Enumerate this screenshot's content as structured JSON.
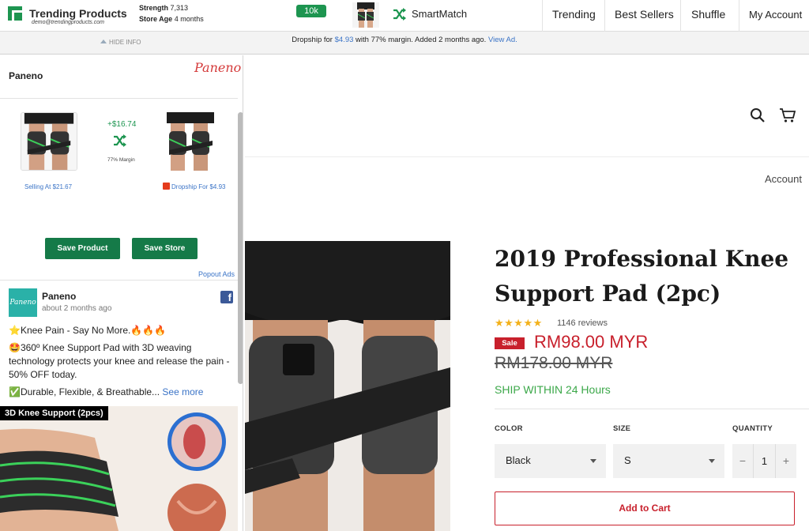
{
  "topbar": {
    "brand_title": "Trending Products",
    "brand_email": "demo@trendingproducts.com",
    "strength_label": "Strength",
    "strength_value": "7,313",
    "store_age_label": "Store Age",
    "store_age_value": "4 months",
    "badge": "10k",
    "smartmatch": "SmartMatch",
    "nav": [
      "Trending",
      "Best Sellers",
      "Shuffle",
      "My Account"
    ],
    "brand_color": "#1d9550"
  },
  "infobar": {
    "hide_info": "HIDE INFO",
    "dropship_prefix": "Dropship for ",
    "dropship_price": "$4.93",
    "dropship_middle": " with 77% margin. Added 2 months ago. ",
    "view_ad": "View Ad."
  },
  "panel": {
    "store_name": "Paneno",
    "store_logo_text": "Paneno",
    "profit": "+$16.74",
    "margin": "77% Margin",
    "selling_at": "Selling At $21.67",
    "dropship_for": "Dropship For $4.93",
    "save_product": "Save Product",
    "save_store": "Save Store",
    "popout_ads": "Popout Ads",
    "ad": {
      "page_name": "Paneno",
      "logo_text": "Paneno",
      "time": "about 2 months ago",
      "lines": [
        "⭐Knee Pain - Say No More.🔥🔥🔥",
        "🤩360º Knee Support Pad with 3D weaving technology protects your knee and release the pain - 50% OFF today.",
        "✅Durable, Flexible, & Breathable..."
      ],
      "see_more": "See more",
      "image_label": "3D Knee Support (2pcs)"
    }
  },
  "store": {
    "account": "Account",
    "product_title": "2019 Professional Knee Support Pad (2pc)",
    "rating_stars": "★★★★★",
    "reviews": "1146 reviews",
    "sale_badge": "Sale",
    "price": "RM98.00 MYR",
    "old_price": "RM178.00 MYR",
    "ship": "SHIP WITHIN 24 Hours",
    "color_label": "COLOR",
    "color_value": "Black",
    "size_label": "SIZE",
    "size_value": "S",
    "quantity_label": "QUANTITY",
    "quantity_value": "1",
    "qty_minus": "−",
    "qty_plus": "+",
    "add_to_cart": "Add to Cart",
    "accent_color": "#c8202c"
  }
}
